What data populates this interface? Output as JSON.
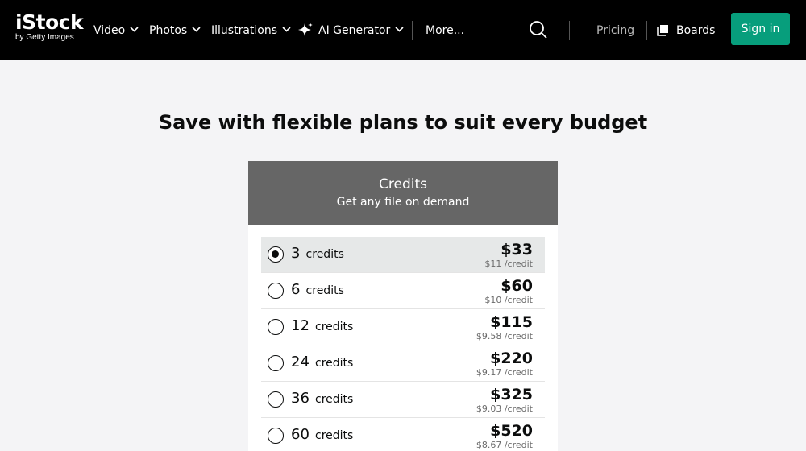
{
  "brand": {
    "name": "iStock",
    "tagline": "by Getty Images"
  },
  "nav": {
    "items": [
      {
        "label": "Video"
      },
      {
        "label": "Photos"
      },
      {
        "label": "Illustrations"
      },
      {
        "label": "AI Generator"
      },
      {
        "label": "More..."
      }
    ],
    "pricing": "Pricing",
    "boards": "Boards",
    "sign_in": "Sign in"
  },
  "headline": "Save with flexible plans to suit every budget",
  "plan": {
    "title": "Credits",
    "subtitle": "Get any file on demand",
    "options": [
      {
        "qty": "3",
        "unit": "credits",
        "price": "$33",
        "per": "$11 /credit",
        "selected": true
      },
      {
        "qty": "6",
        "unit": "credits",
        "price": "$60",
        "per": "$10 /credit",
        "selected": false
      },
      {
        "qty": "12",
        "unit": "credits",
        "price": "$115",
        "per": "$9.58 /credit",
        "selected": false
      },
      {
        "qty": "24",
        "unit": "credits",
        "price": "$220",
        "per": "$9.17 /credit",
        "selected": false
      },
      {
        "qty": "36",
        "unit": "credits",
        "price": "$325",
        "per": "$9.03 /credit",
        "selected": false
      },
      {
        "qty": "60",
        "unit": "credits",
        "price": "$520",
        "per": "$8.67 /credit",
        "selected": false
      }
    ]
  },
  "colors": {
    "nav_bg": "#000000",
    "accent": "#079e7c",
    "card_header": "#666666",
    "page_bg": "#f4f4f6"
  },
  "icons": [
    "chevron-down-icon",
    "sparkle-icon",
    "search-icon",
    "boards-icon",
    "radio-icon"
  ]
}
